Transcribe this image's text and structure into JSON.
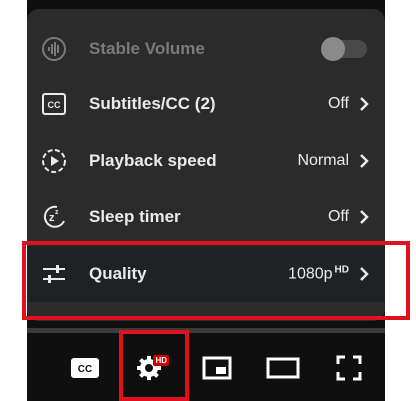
{
  "menu": {
    "items": [
      {
        "label": "Stable Volume",
        "value": "",
        "icon": "stable-volume-icon",
        "disabled": true
      },
      {
        "label": "Subtitles/CC (2)",
        "value": "Off",
        "icon": "subtitles-cc-icon"
      },
      {
        "label": "Playback speed",
        "value": "Normal",
        "icon": "playback-speed-icon"
      },
      {
        "label": "Sleep timer",
        "value": "Off",
        "icon": "sleep-timer-icon"
      },
      {
        "label": "Quality",
        "value": "1080p",
        "badge": "HD",
        "icon": "quality-sliders-icon"
      }
    ]
  },
  "controls": {
    "settings_badge": "HD",
    "buttons": [
      "subtitles-button",
      "settings-button",
      "miniplayer-button",
      "theater-mode-button",
      "fullscreen-button"
    ]
  },
  "toggle": {
    "stable_volume_on": false
  },
  "colors": {
    "menu_bg": "#2b2b2b",
    "highlight": "#e0101e",
    "badge": "#cc0000",
    "text": "#eaeaea"
  }
}
